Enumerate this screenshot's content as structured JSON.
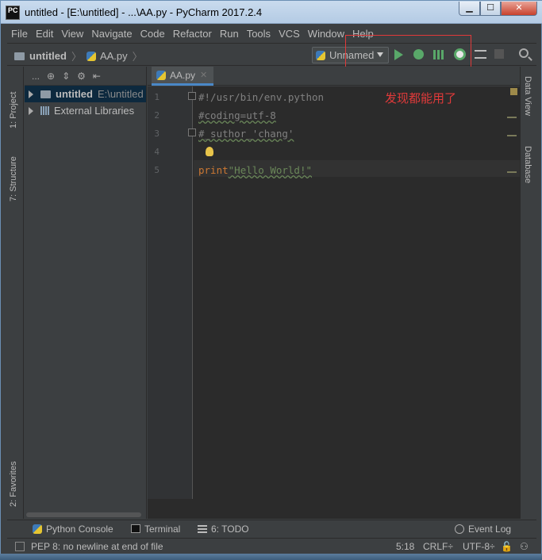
{
  "window": {
    "title": "untitled - [E:\\untitled] - ...\\AA.py - PyCharm 2017.2.4",
    "app_icon_text": "PC",
    "controls": {
      "minimize": "▁",
      "maximize": "☐",
      "close": "✕"
    }
  },
  "menu": [
    "File",
    "Edit",
    "View",
    "Navigate",
    "Code",
    "Refactor",
    "Run",
    "Tools",
    "VCS",
    "Window",
    "Help"
  ],
  "breadcrumb": {
    "project": "untitled",
    "file": "AA.py"
  },
  "run_config": {
    "label": "Unnamed"
  },
  "left_tabs": {
    "project": "1: Project",
    "structure": "7: Structure",
    "favorites": "2: Favorites"
  },
  "project_panel": {
    "toolbar_label": "...",
    "tree": [
      {
        "name": "untitled",
        "path": "E:\\untitled"
      },
      {
        "name": "External Libraries"
      }
    ]
  },
  "editor": {
    "tab_label": "AA.py",
    "line_numbers": [
      "1",
      "2",
      "3",
      "4",
      "5"
    ],
    "lines": {
      "l1": "#!/usr/bin/env.python",
      "l2": "#coding=utf-8",
      "l3": "#_suthor_'chang'",
      "l5_kw": "print",
      "l5_str": "\"Hello World!\""
    }
  },
  "annotation": "发现都能用了",
  "right_tabs": {
    "data_view": "Data View",
    "database": "Database"
  },
  "bottom_tools": {
    "python_console": "Python Console",
    "terminal": "Terminal",
    "todo": "6: TODO",
    "event_log": "Event Log"
  },
  "status": {
    "message": "PEP 8: no newline at end of file",
    "position": "5:18",
    "line_sep": "CRLF÷",
    "encoding": "UTF-8÷"
  },
  "colors": {
    "accent": "#4a88c7",
    "run_green": "#59a869",
    "highlight_red": "#e03a3a"
  }
}
